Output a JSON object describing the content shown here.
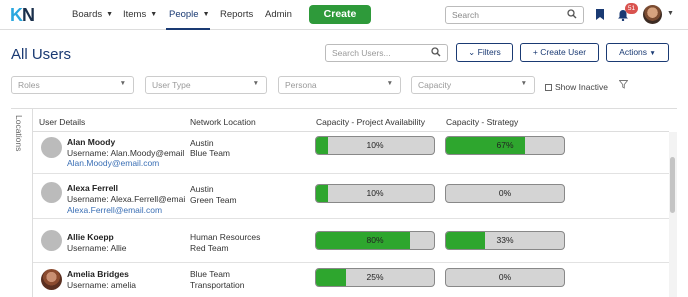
{
  "logo": {
    "k": "K",
    "n": "N"
  },
  "nav": {
    "boards": "Boards",
    "items": "Items",
    "people": "People",
    "reports": "Reports",
    "admin": "Admin",
    "create": "Create",
    "search_placeholder": "Search",
    "notification_count": "51"
  },
  "header": {
    "title": "All Users",
    "search_placeholder": "Search Users...",
    "filters": "Filters",
    "create_user": "+ Create User",
    "actions": "Actions"
  },
  "filters": {
    "roles": "Roles",
    "user_type": "User Type",
    "persona": "Persona",
    "capacity": "Capacity",
    "show_inactive": "Show Inactive"
  },
  "side_tab": "Locations",
  "table": {
    "columns": [
      "User Details",
      "Network Location",
      "Capacity - Project Availability",
      "Capacity - Strategy"
    ],
    "rows": [
      {
        "name": "Alan Moody",
        "username": "Username: Alan.Moody@email.c",
        "email": "Alan.Moody@email.com",
        "net1": "Austin",
        "net2": "Blue Team",
        "cap1": "10%",
        "cap1_value": 10,
        "cap2": "67%",
        "cap2_value": 67,
        "photo": false
      },
      {
        "name": "Alexa Ferrell",
        "username": "Username: Alexa.Ferrell@email.c",
        "email": "Alexa.Ferrell@email.com",
        "net1": "Austin",
        "net2": "Green Team",
        "cap1": "10%",
        "cap1_value": 10,
        "cap2": "0%",
        "cap2_value": 0,
        "photo": false
      },
      {
        "name": "Allie Koepp",
        "username": "Username: Allie",
        "email": "",
        "net1": "Human Resources",
        "net2": "Red Team",
        "cap1": "80%",
        "cap1_value": 80,
        "cap2": "33%",
        "cap2_value": 33,
        "photo": false
      },
      {
        "name": "Amelia Bridges",
        "username": "Username: amelia",
        "email": "",
        "net1": "Blue Team",
        "net2": "Transportation",
        "cap1": "25%",
        "cap1_value": 25,
        "cap2": "0%",
        "cap2_value": 0,
        "photo": true
      }
    ]
  },
  "colors": {
    "accent": "#1a3a73",
    "create": "#2e9a3a",
    "bar_fill": "#2ea62e",
    "link": "#3a6fb5",
    "badge": "#d9534f"
  }
}
